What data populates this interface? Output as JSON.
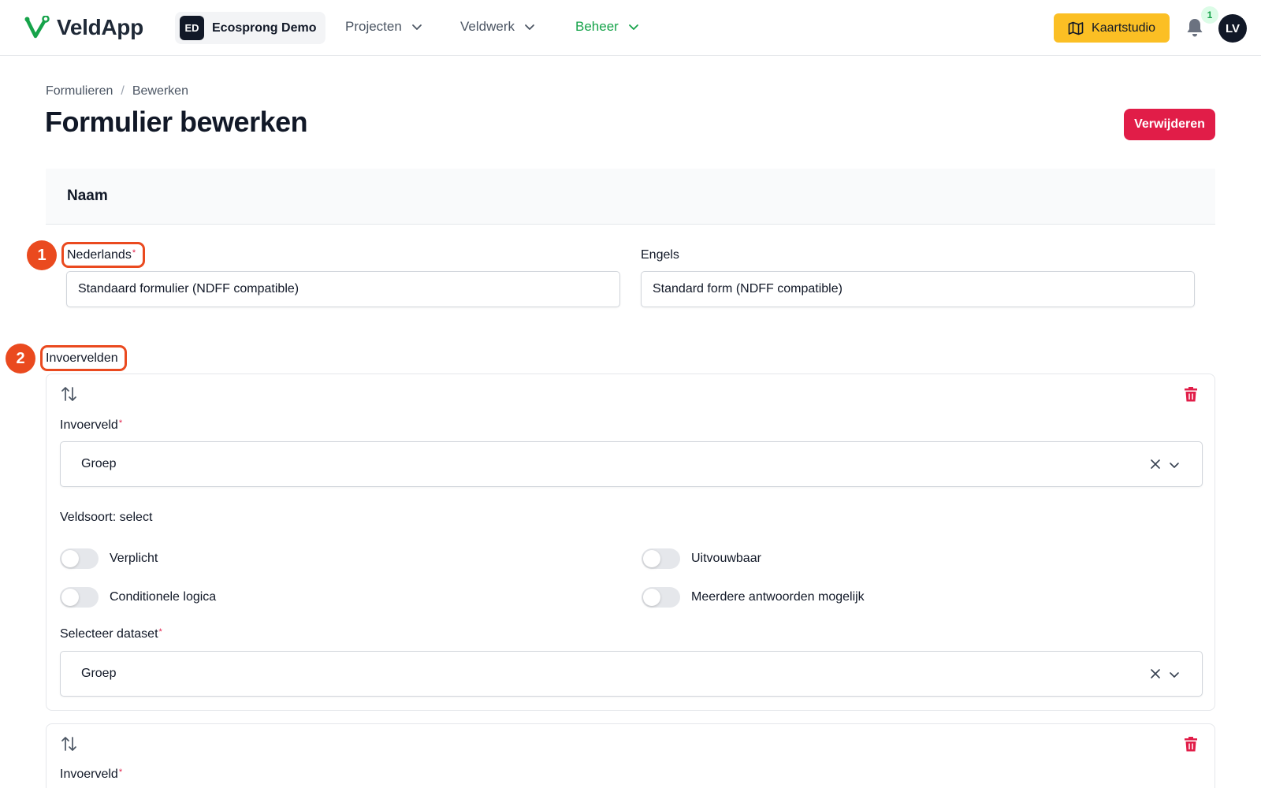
{
  "header": {
    "app_name": "VeldApp",
    "org_badge": "ED",
    "org_name": "Ecosprong Demo",
    "nav": [
      {
        "label": "Projecten"
      },
      {
        "label": "Veldwerk"
      },
      {
        "label": "Beheer"
      }
    ],
    "map_button": "Kaartstudio",
    "notification_count": "1",
    "avatar": "LV",
    "colors": {
      "brand": "#16a34a",
      "map_button": "#fbbf24",
      "danger": "#e11d48"
    }
  },
  "breadcrumb": [
    "Formulieren",
    "/",
    "Bewerken"
  ],
  "page_title": "Formulier bewerken",
  "delete_button": "Verwijderen",
  "naam_section": {
    "title": "Naam",
    "dutch_label": "Nederlands",
    "dutch_value": "Standaard formulier (NDFF compatible)",
    "english_label": "Engels",
    "english_value": "Standard form (NDFF compatible)"
  },
  "markers": [
    "1",
    "2"
  ],
  "invoervelden": {
    "title": "Invoervelden",
    "cards": [
      {
        "field_label": "Invoerveld",
        "field_value": "Groep",
        "field_type": "Veldsoort: select",
        "toggles": [
          {
            "label": "Verplicht",
            "on": false
          },
          {
            "label": "Uitvouwbaar",
            "on": false
          },
          {
            "label": "Conditionele logica",
            "on": false
          },
          {
            "label": "Meerdere antwoorden mogelijk",
            "on": false
          }
        ],
        "dataset_label": "Selecteer dataset",
        "dataset_value": "Groep"
      },
      {
        "field_label": "Invoerveld"
      }
    ]
  },
  "required_mark": "*"
}
